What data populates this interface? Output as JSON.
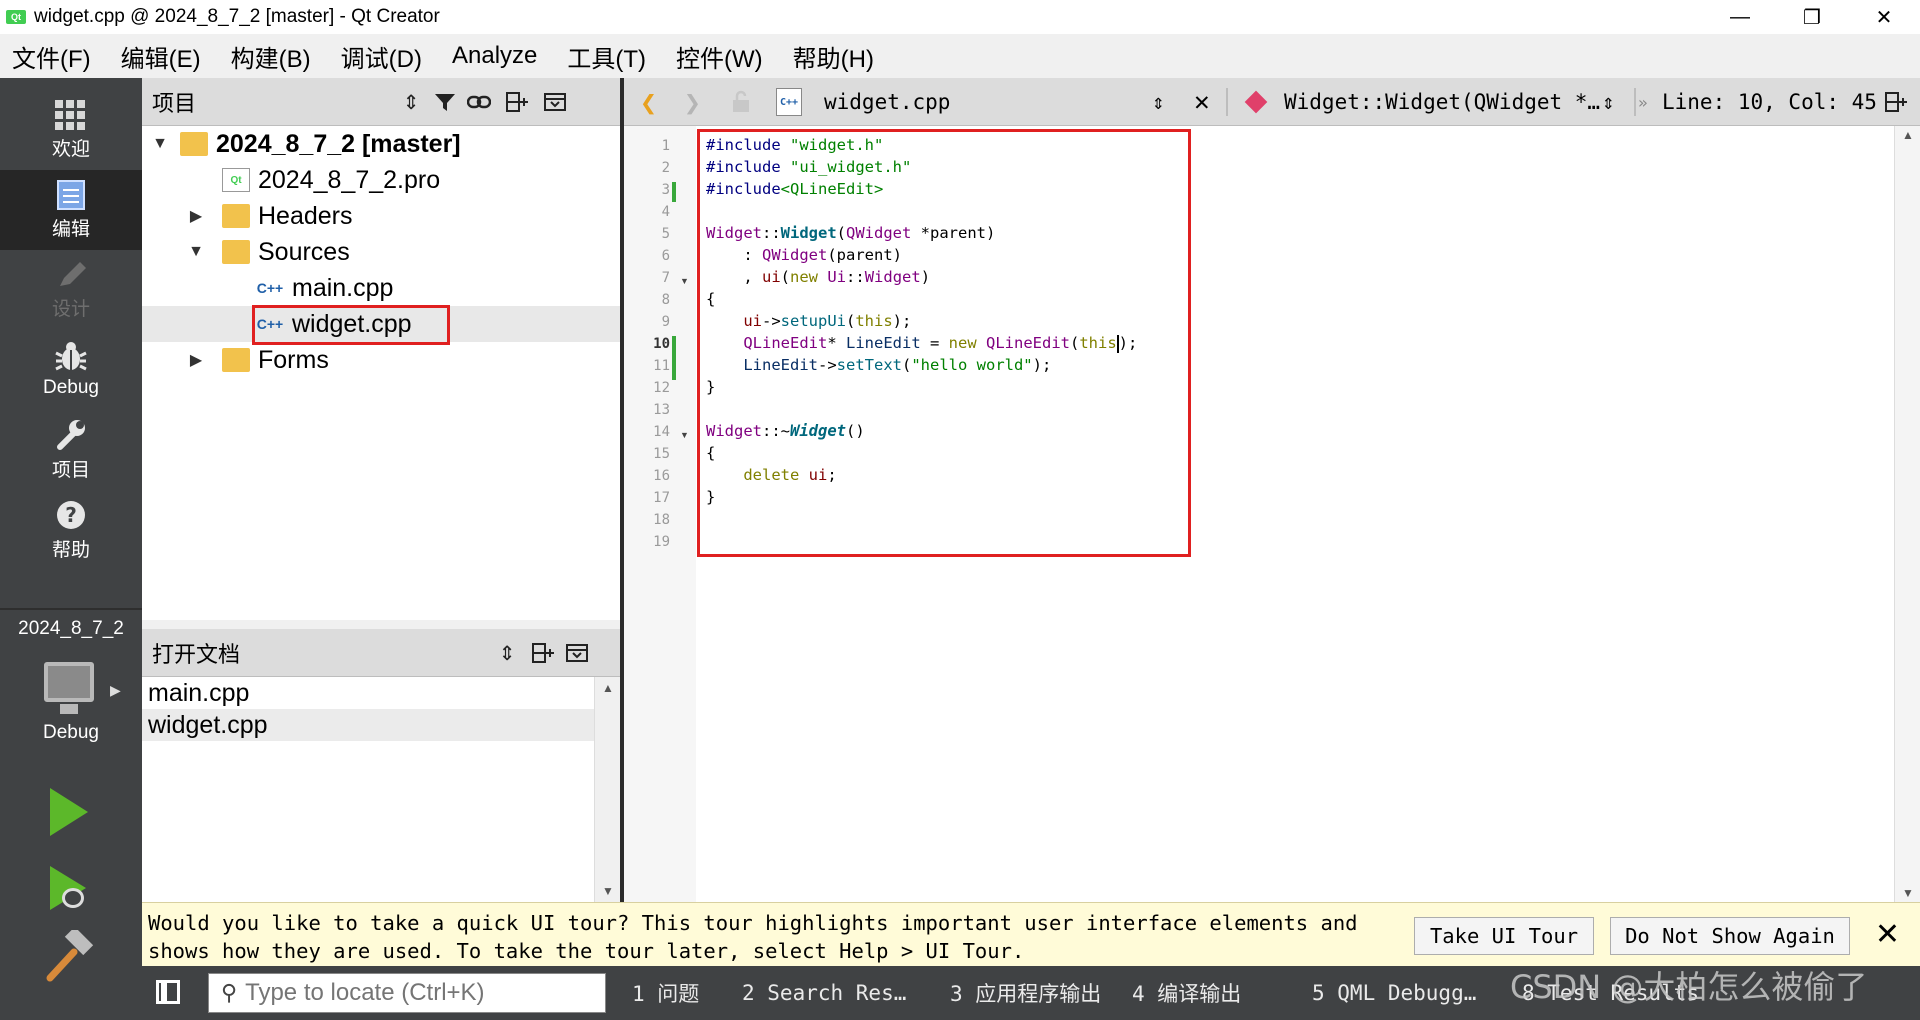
{
  "window": {
    "title": "widget.cpp @ 2024_8_7_2 [master] - Qt Creator",
    "icon_label": "Qt",
    "minimize": "—",
    "restore": "❐",
    "close": "✕"
  },
  "menu": [
    "文件(F)",
    "编辑(E)",
    "构建(B)",
    "调试(D)",
    "Analyze",
    "工具(T)",
    "控件(W)",
    "帮助(H)"
  ],
  "modes": [
    {
      "label": "欢迎",
      "icon": "grid-icon"
    },
    {
      "label": "编辑",
      "icon": "edit-icon"
    },
    {
      "label": "设计",
      "icon": "pencil-icon"
    },
    {
      "label": "Debug",
      "icon": "bug-icon"
    },
    {
      "label": "项目",
      "icon": "wrench-icon"
    },
    {
      "label": "帮助",
      "icon": "help-icon"
    }
  ],
  "kit": {
    "project": "2024_8_7_2",
    "config": "Debug"
  },
  "project_panel": {
    "title": "项目",
    "root": "2024_8_7_2 [master]",
    "pro_file": "2024_8_7_2.pro",
    "headers": "Headers",
    "sources": "Sources",
    "main_cpp": "main.cpp",
    "widget_cpp": "widget.cpp",
    "forms": "Forms"
  },
  "open_documents": {
    "title": "打开文档",
    "items": [
      "main.cpp",
      "widget.cpp"
    ]
  },
  "editor_toolbar": {
    "file_name": "widget.cpp",
    "file_icon": "C++",
    "symbol": "Widget::Widget(QWidget *…",
    "position": "Line: 10, Col: 45"
  },
  "editor": {
    "line_numbers": [
      "1",
      "2",
      "3",
      "4",
      "5",
      "6",
      "7",
      "8",
      "9",
      "10",
      "11",
      "12",
      "13",
      "14",
      "15",
      "16",
      "17",
      "18",
      "19"
    ],
    "current_line": 10
  },
  "infobar": {
    "message": "Would you like to take a quick UI tour? This tour highlights important user interface elements and shows how they are used. To take the tour later, select Help > UI Tour.",
    "take_tour": "Take UI Tour",
    "dont_show": "Do Not Show Again",
    "close": "✕"
  },
  "bottom": {
    "locator_placeholder": "Type to locate (Ctrl+K)",
    "tabs": [
      "1  问题",
      "2  Search Res…",
      "3  应用程序输出",
      "4  编译输出",
      "5  QML Debugg…",
      "8  Test Results"
    ]
  },
  "watermark": "CSDN @大柏怎么被偷了",
  "colors": {
    "accent_red": "#e02020",
    "mode_bar": "#404244",
    "run_green": "#5cb82a"
  }
}
